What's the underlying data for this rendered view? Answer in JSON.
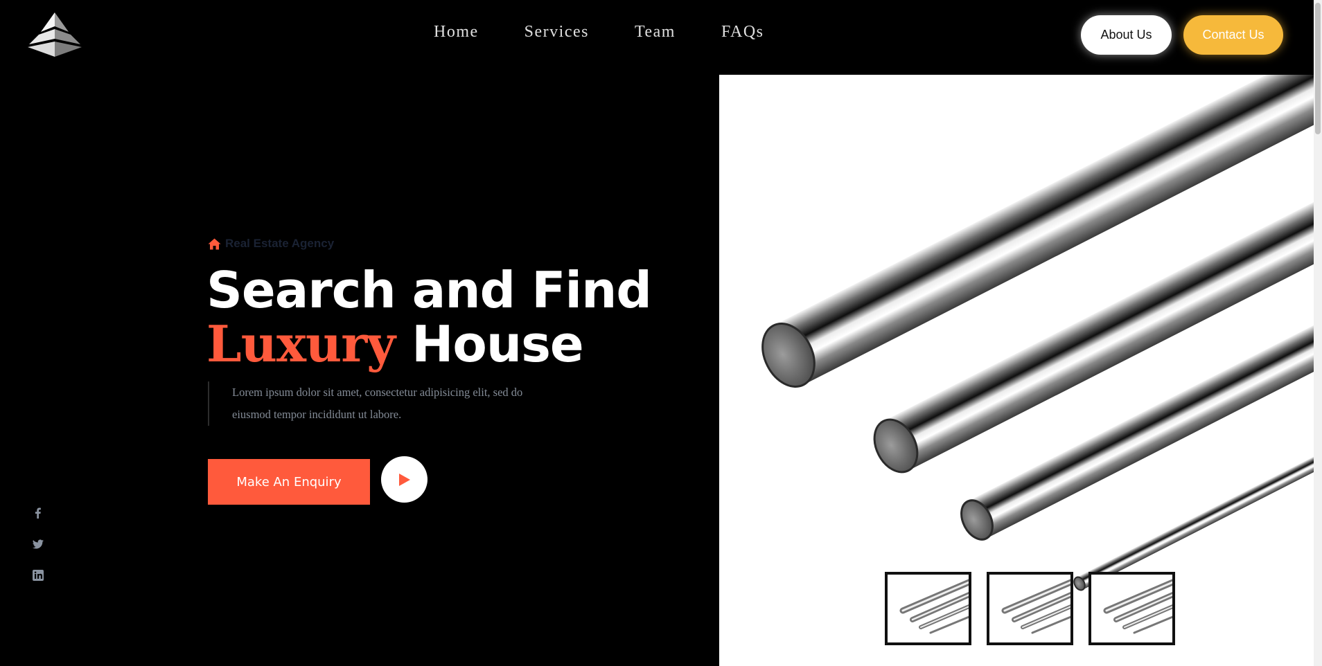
{
  "header": {
    "logo_icon": "pyramid-logo-icon",
    "nav": [
      {
        "label": "Home"
      },
      {
        "label": "Services"
      },
      {
        "label": "Team"
      },
      {
        "label": "FAQs"
      }
    ],
    "about_label": "About Us",
    "contact_label": "Contact Us"
  },
  "hero": {
    "eyebrow_icon": "home-icon",
    "eyebrow": "Real Estate Agency",
    "title_line1": "Search and Find",
    "title_accent": "Luxury",
    "title_rest": "House",
    "description_line1": "Lorem ipsum dolor sit amet, consectetur adipisicing elit, sed do",
    "description_line2": "eiusmod tempor incididunt ut labore.",
    "enquiry_label": "Make An Enquiry",
    "play_icon": "play-icon"
  },
  "social": [
    "facebook-icon",
    "twitter-icon",
    "linkedin-icon"
  ],
  "gallery": {
    "main_image": "steel-rods-image",
    "thumbnails": [
      "steel-rods-thumbnail",
      "steel-rods-thumbnail",
      "steel-rods-thumbnail"
    ]
  },
  "colors": {
    "accent": "#ff5a3c",
    "contact_button": "#f6b93b",
    "background": "#000000"
  }
}
